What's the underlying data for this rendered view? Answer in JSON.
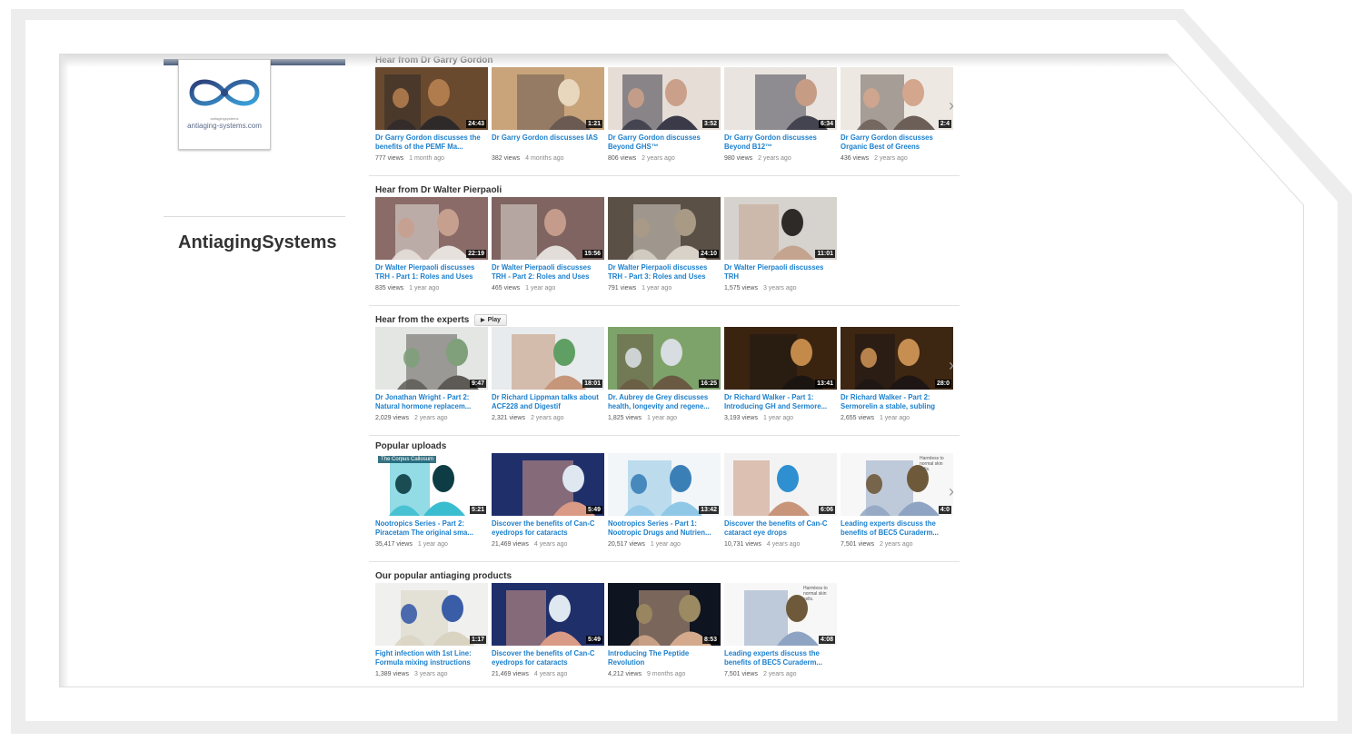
{
  "channel": {
    "name": "AntiagingSystems",
    "logo_tagline": "antiagingsystems",
    "logo_text": "antiaging-systems.com"
  },
  "play_label": "Play",
  "shelves": [
    {
      "title": "Hear from Dr Garry Gordon",
      "has_play": false,
      "has_next": true,
      "videos": [
        {
          "title": "Dr Garry Gordon discusses the benefits of the PEMF Ma...",
          "duration": "24:43",
          "views": "777 views",
          "age": "1 month ago",
          "palette": [
            "#6a4a2e",
            "#b07c4d",
            "#2f2a2a"
          ]
        },
        {
          "title": "Dr Garry Gordon discusses IAS",
          "duration": "1:21",
          "views": "382 views",
          "age": "4 months ago",
          "palette": [
            "#c9a47a",
            "#e8d6bd",
            "#6a5a52"
          ]
        },
        {
          "title": "Dr Garry Gordon discusses Beyond GHS™",
          "duration": "3:52",
          "views": "806 views",
          "age": "2 years ago",
          "palette": [
            "#e6ded6",
            "#caa08a",
            "#3a3a48"
          ]
        },
        {
          "title": "Dr Garry Gordon discusses Beyond B12™",
          "duration": "6:34",
          "views": "980 views",
          "age": "2 years ago",
          "palette": [
            "#e9e4df",
            "#c69c85",
            "#444450"
          ]
        },
        {
          "title": "Dr Garry Gordon discusses Organic Best of Greens",
          "duration": "2:4",
          "views": "436 views",
          "age": "2 years ago",
          "palette": [
            "#ede8e2",
            "#d3a68d",
            "#6b5f58"
          ]
        }
      ]
    },
    {
      "title": "Hear from Dr Walter Pierpaoli",
      "has_play": false,
      "has_next": false,
      "videos": [
        {
          "title": "Dr Walter Pierpaoli discusses TRH - Part 1: Roles and Uses",
          "duration": "22:19",
          "views": "835 views",
          "age": "1 year ago",
          "palette": [
            "#8a6b68",
            "#c79f8e",
            "#e6e1dc"
          ]
        },
        {
          "title": "Dr Walter Pierpaoli discusses TRH - Part 2: Roles and Uses",
          "duration": "15:56",
          "views": "465 views",
          "age": "1 year ago",
          "palette": [
            "#7f6461",
            "#c59c8b",
            "#e2ddd8"
          ]
        },
        {
          "title": "Dr Walter Pierpaoli discusses TRH - Part 3: Roles and Uses",
          "duration": "24:10",
          "views": "791 views",
          "age": "1 year ago",
          "palette": [
            "#5a5046",
            "#a99a86",
            "#d8d2c8"
          ]
        },
        {
          "title": "Dr Walter Pierpaoli discusses TRH",
          "duration": "11:01",
          "views": "1,575 views",
          "age": "3 years ago",
          "palette": [
            "#d6d2ce",
            "#2e2a28",
            "#c4a48e"
          ]
        }
      ]
    },
    {
      "title": "Hear from the experts",
      "has_play": true,
      "has_next": true,
      "videos": [
        {
          "title": "Dr Jonathan Wright - Part 2: Natural hormone replacem...",
          "duration": "9:47",
          "views": "2,029 views",
          "age": "2 years ago",
          "palette": [
            "#e4e6e4",
            "#7fa07a",
            "#5d5a55"
          ]
        },
        {
          "title": "Dr Richard Lippman talks about ACF228 and Digestif",
          "duration": "18:01",
          "views": "2,321 views",
          "age": "2 years ago",
          "palette": [
            "#e7ebee",
            "#5f9f63",
            "#c59679"
          ]
        },
        {
          "title": "Dr. Aubrey de Grey discusses health, longevity and regene...",
          "duration": "16:25",
          "views": "1,825 views",
          "age": "1 year ago",
          "palette": [
            "#7da36a",
            "#d7dde0",
            "#6a5a44"
          ]
        },
        {
          "title": "Dr Richard Walker - Part 1: Introducing GH and Sermore...",
          "duration": "13:41",
          "views": "3,193 views",
          "age": "1 year ago",
          "palette": [
            "#3a2410",
            "#c38a4a",
            "#1b1512"
          ]
        },
        {
          "title": "Dr Richard Walker - Part 2: Sermorelin a stable, subling",
          "duration": "28:0",
          "views": "2,655 views",
          "age": "1 year ago",
          "palette": [
            "#3d2612",
            "#c78e52",
            "#1d1614"
          ]
        }
      ]
    },
    {
      "title": "Popular uploads",
      "has_play": false,
      "has_next": true,
      "videos": [
        {
          "title": "Nootropics Series - Part 2: Piracetam The original sma...",
          "duration": "5:21",
          "views": "35,417 views",
          "age": "1 year ago",
          "palette": [
            "#ffffff",
            "#0d3c44",
            "#3bbdd0"
          ],
          "overlay_text": "The Corpus Callosum"
        },
        {
          "title": "Discover the benefits of Can-C eyedrops for cataracts",
          "duration": "5:49",
          "views": "21,469 views",
          "age": "4 years ago",
          "palette": [
            "#1f2f6a",
            "#dfe7f0",
            "#d99a86"
          ]
        },
        {
          "title": "Nootropics Series - Part 1: Nootropic Drugs and Nutrien...",
          "duration": "13:42",
          "views": "20,517 views",
          "age": "1 year ago",
          "palette": [
            "#f2f6f9",
            "#3b7fb7",
            "#8fc7e6"
          ]
        },
        {
          "title": "Discover the benefits of Can-C cataract eye drops",
          "duration": "6:06",
          "views": "10,731 views",
          "age": "4 years ago",
          "palette": [
            "#f3f3f3",
            "#2e8fd1",
            "#c8957a"
          ]
        },
        {
          "title": "Leading experts discuss the benefits of BEC5 Curaderm...",
          "duration": "4:0",
          "views": "7,501 views",
          "age": "2 years ago",
          "palette": [
            "#f7f7f7",
            "#6e5a3a",
            "#8fa4c2"
          ],
          "overlay_text": "Harmless to normal skin cells."
        }
      ]
    },
    {
      "title": "Our popular antiaging products",
      "has_play": false,
      "has_next": false,
      "videos": [
        {
          "title": "Fight infection with 1st Line: Formula mixing instructions",
          "duration": "1:17",
          "views": "1,389 views",
          "age": "3 years ago",
          "palette": [
            "#f0f0ee",
            "#3a5da8",
            "#d9d3c2"
          ]
        },
        {
          "title": "Discover the benefits of Can-C eyedrops for cataracts",
          "duration": "5:49",
          "views": "21,469 views",
          "age": "4 years ago",
          "palette": [
            "#1f2f6a",
            "#dfe7f0",
            "#d99a86"
          ]
        },
        {
          "title": "Introducing The Peptide Revolution",
          "duration": "8:53",
          "views": "4,212 views",
          "age": "9 months ago",
          "palette": [
            "#0e1420",
            "#9c8a62",
            "#d4a98c"
          ]
        },
        {
          "title": "Leading experts discuss the benefits of BEC5 Curaderm...",
          "duration": "4:08",
          "views": "7,501 views",
          "age": "2 years ago",
          "palette": [
            "#f7f7f7",
            "#6e5a3a",
            "#8fa4c2"
          ],
          "overlay_text": "Harmless to normal skin cells."
        }
      ]
    }
  ]
}
